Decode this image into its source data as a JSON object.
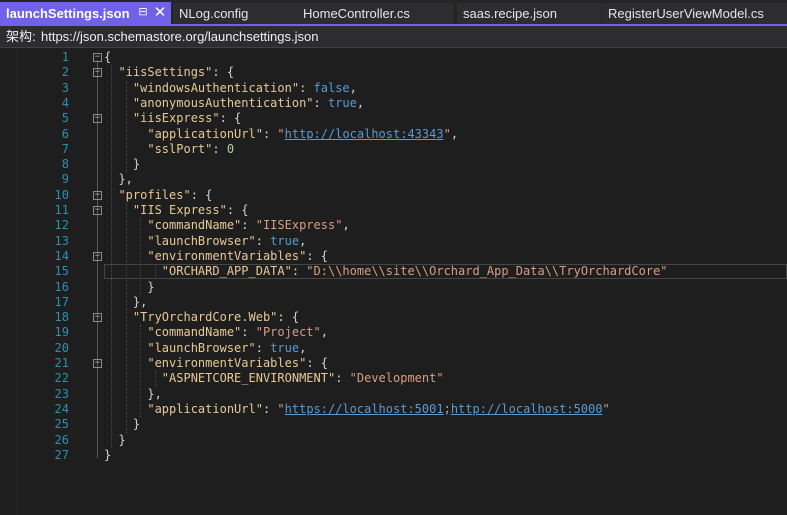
{
  "tabs": [
    {
      "label": "launchSettings.json",
      "active": true
    },
    {
      "label": "NLog.config"
    },
    {
      "label": "HomeController.cs"
    },
    {
      "label": "saas.recipe.json"
    },
    {
      "label": "RegisterUserViewModel.cs"
    }
  ],
  "schema": {
    "label": "架构:",
    "url": "https://json.schemastore.org/launchsettings.json"
  },
  "icons": {
    "pin": "pin-icon",
    "close": "close-icon",
    "fold": "fold-toggle-icon"
  },
  "colors": {
    "accent": "#7160e8",
    "key": "#e7c997",
    "string": "#d69d85",
    "keyword": "#569cd6",
    "line_number": "#2b91af"
  },
  "code_lines": [
    {
      "n": "1",
      "fold": true,
      "parts": [
        [
          "p",
          "{"
        ]
      ]
    },
    {
      "n": "2",
      "fold": true,
      "parts": [
        [
          "p",
          "  "
        ],
        [
          "k",
          "\"iisSettings\""
        ],
        [
          "p",
          ": {"
        ]
      ]
    },
    {
      "n": "3",
      "parts": [
        [
          "p",
          "    "
        ],
        [
          "k",
          "\"windowsAuthentication\""
        ],
        [
          "p",
          ": "
        ],
        [
          "b",
          "false"
        ],
        [
          "p",
          ","
        ]
      ]
    },
    {
      "n": "4",
      "parts": [
        [
          "p",
          "    "
        ],
        [
          "k",
          "\"anonymousAuthentication\""
        ],
        [
          "p",
          ": "
        ],
        [
          "b",
          "true"
        ],
        [
          "p",
          ","
        ]
      ]
    },
    {
      "n": "5",
      "fold": true,
      "parts": [
        [
          "p",
          "    "
        ],
        [
          "k",
          "\"iisExpress\""
        ],
        [
          "p",
          ": {"
        ]
      ]
    },
    {
      "n": "6",
      "parts": [
        [
          "p",
          "      "
        ],
        [
          "k",
          "\"applicationUrl\""
        ],
        [
          "p",
          ": "
        ],
        [
          "s",
          "\""
        ],
        [
          "u",
          "http://localhost:43343"
        ],
        [
          "s",
          "\""
        ],
        [
          "p",
          ","
        ]
      ]
    },
    {
      "n": "7",
      "parts": [
        [
          "p",
          "      "
        ],
        [
          "k",
          "\"sslPort\""
        ],
        [
          "p",
          ": "
        ],
        [
          "n",
          "0"
        ]
      ]
    },
    {
      "n": "8",
      "parts": [
        [
          "p",
          "    }"
        ]
      ]
    },
    {
      "n": "9",
      "parts": [
        [
          "p",
          "  },"
        ]
      ]
    },
    {
      "n": "10",
      "fold": true,
      "parts": [
        [
          "p",
          "  "
        ],
        [
          "k",
          "\"profiles\""
        ],
        [
          "p",
          ": {"
        ]
      ]
    },
    {
      "n": "11",
      "fold": true,
      "parts": [
        [
          "p",
          "    "
        ],
        [
          "k",
          "\"IIS Express\""
        ],
        [
          "p",
          ": {"
        ]
      ]
    },
    {
      "n": "12",
      "parts": [
        [
          "p",
          "      "
        ],
        [
          "k",
          "\"commandName\""
        ],
        [
          "p",
          ": "
        ],
        [
          "s",
          "\"IISExpress\""
        ],
        [
          "p",
          ","
        ]
      ]
    },
    {
      "n": "13",
      "parts": [
        [
          "p",
          "      "
        ],
        [
          "k",
          "\"launchBrowser\""
        ],
        [
          "p",
          ": "
        ],
        [
          "b",
          "true"
        ],
        [
          "p",
          ","
        ]
      ]
    },
    {
      "n": "14",
      "fold": true,
      "parts": [
        [
          "p",
          "      "
        ],
        [
          "k",
          "\"environmentVariables\""
        ],
        [
          "p",
          ": {"
        ]
      ]
    },
    {
      "n": "15",
      "current": true,
      "parts": [
        [
          "p",
          "        "
        ],
        [
          "k",
          "\"ORCHARD_APP_DATA\""
        ],
        [
          "p",
          ": "
        ],
        [
          "s",
          "\"D:\\\\home\\\\site\\\\Orchard_App_Data\\\\TryOrchardCore\""
        ]
      ]
    },
    {
      "n": "16",
      "parts": [
        [
          "p",
          "      }"
        ]
      ]
    },
    {
      "n": "17",
      "parts": [
        [
          "p",
          "    },"
        ]
      ]
    },
    {
      "n": "18",
      "fold": true,
      "parts": [
        [
          "p",
          "    "
        ],
        [
          "k",
          "\"TryOrchardCore.Web\""
        ],
        [
          "p",
          ": {"
        ]
      ]
    },
    {
      "n": "19",
      "parts": [
        [
          "p",
          "      "
        ],
        [
          "k",
          "\"commandName\""
        ],
        [
          "p",
          ": "
        ],
        [
          "s",
          "\"Project\""
        ],
        [
          "p",
          ","
        ]
      ]
    },
    {
      "n": "20",
      "parts": [
        [
          "p",
          "      "
        ],
        [
          "k",
          "\"launchBrowser\""
        ],
        [
          "p",
          ": "
        ],
        [
          "b",
          "true"
        ],
        [
          "p",
          ","
        ]
      ]
    },
    {
      "n": "21",
      "fold": true,
      "parts": [
        [
          "p",
          "      "
        ],
        [
          "k",
          "\"environmentVariables\""
        ],
        [
          "p",
          ": {"
        ]
      ]
    },
    {
      "n": "22",
      "parts": [
        [
          "p",
          "        "
        ],
        [
          "k",
          "\"ASPNETCORE_ENVIRONMENT\""
        ],
        [
          "p",
          ": "
        ],
        [
          "s",
          "\"Development\""
        ]
      ]
    },
    {
      "n": "23",
      "parts": [
        [
          "p",
          "      },"
        ]
      ]
    },
    {
      "n": "24",
      "parts": [
        [
          "p",
          "      "
        ],
        [
          "k",
          "\"applicationUrl\""
        ],
        [
          "p",
          ": "
        ],
        [
          "s",
          "\""
        ],
        [
          "u",
          "https://localhost:5001"
        ],
        [
          "s",
          ";"
        ],
        [
          "u",
          "http://localhost:5000"
        ],
        [
          "s",
          "\""
        ]
      ]
    },
    {
      "n": "25",
      "parts": [
        [
          "p",
          "    }"
        ]
      ]
    },
    {
      "n": "26",
      "parts": [
        [
          "p",
          "  }"
        ]
      ]
    },
    {
      "n": "27",
      "parts": [
        [
          "p",
          "}"
        ]
      ]
    }
  ]
}
